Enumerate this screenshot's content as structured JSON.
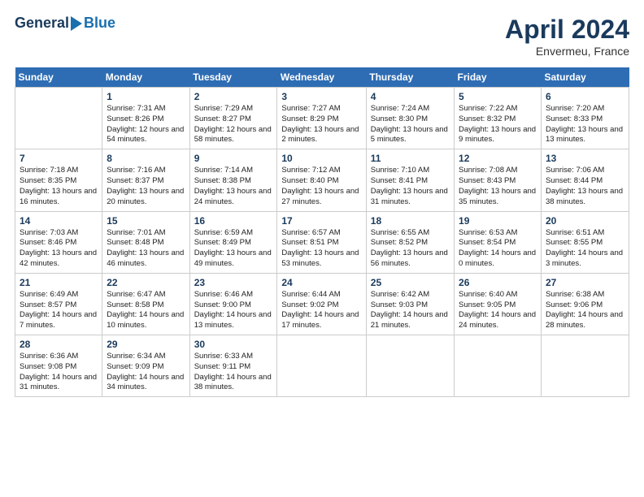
{
  "header": {
    "logo_general": "General",
    "logo_blue": "Blue",
    "month_year": "April 2024",
    "location": "Envermeu, France"
  },
  "weekdays": [
    "Sunday",
    "Monday",
    "Tuesday",
    "Wednesday",
    "Thursday",
    "Friday",
    "Saturday"
  ],
  "weeks": [
    [
      {
        "day": "",
        "sunrise": "",
        "sunset": "",
        "daylight": ""
      },
      {
        "day": "1",
        "sunrise": "Sunrise: 7:31 AM",
        "sunset": "Sunset: 8:26 PM",
        "daylight": "Daylight: 12 hours and 54 minutes."
      },
      {
        "day": "2",
        "sunrise": "Sunrise: 7:29 AM",
        "sunset": "Sunset: 8:27 PM",
        "daylight": "Daylight: 12 hours and 58 minutes."
      },
      {
        "day": "3",
        "sunrise": "Sunrise: 7:27 AM",
        "sunset": "Sunset: 8:29 PM",
        "daylight": "Daylight: 13 hours and 2 minutes."
      },
      {
        "day": "4",
        "sunrise": "Sunrise: 7:24 AM",
        "sunset": "Sunset: 8:30 PM",
        "daylight": "Daylight: 13 hours and 5 minutes."
      },
      {
        "day": "5",
        "sunrise": "Sunrise: 7:22 AM",
        "sunset": "Sunset: 8:32 PM",
        "daylight": "Daylight: 13 hours and 9 minutes."
      },
      {
        "day": "6",
        "sunrise": "Sunrise: 7:20 AM",
        "sunset": "Sunset: 8:33 PM",
        "daylight": "Daylight: 13 hours and 13 minutes."
      }
    ],
    [
      {
        "day": "7",
        "sunrise": "Sunrise: 7:18 AM",
        "sunset": "Sunset: 8:35 PM",
        "daylight": "Daylight: 13 hours and 16 minutes."
      },
      {
        "day": "8",
        "sunrise": "Sunrise: 7:16 AM",
        "sunset": "Sunset: 8:37 PM",
        "daylight": "Daylight: 13 hours and 20 minutes."
      },
      {
        "day": "9",
        "sunrise": "Sunrise: 7:14 AM",
        "sunset": "Sunset: 8:38 PM",
        "daylight": "Daylight: 13 hours and 24 minutes."
      },
      {
        "day": "10",
        "sunrise": "Sunrise: 7:12 AM",
        "sunset": "Sunset: 8:40 PM",
        "daylight": "Daylight: 13 hours and 27 minutes."
      },
      {
        "day": "11",
        "sunrise": "Sunrise: 7:10 AM",
        "sunset": "Sunset: 8:41 PM",
        "daylight": "Daylight: 13 hours and 31 minutes."
      },
      {
        "day": "12",
        "sunrise": "Sunrise: 7:08 AM",
        "sunset": "Sunset: 8:43 PM",
        "daylight": "Daylight: 13 hours and 35 minutes."
      },
      {
        "day": "13",
        "sunrise": "Sunrise: 7:06 AM",
        "sunset": "Sunset: 8:44 PM",
        "daylight": "Daylight: 13 hours and 38 minutes."
      }
    ],
    [
      {
        "day": "14",
        "sunrise": "Sunrise: 7:03 AM",
        "sunset": "Sunset: 8:46 PM",
        "daylight": "Daylight: 13 hours and 42 minutes."
      },
      {
        "day": "15",
        "sunrise": "Sunrise: 7:01 AM",
        "sunset": "Sunset: 8:48 PM",
        "daylight": "Daylight: 13 hours and 46 minutes."
      },
      {
        "day": "16",
        "sunrise": "Sunrise: 6:59 AM",
        "sunset": "Sunset: 8:49 PM",
        "daylight": "Daylight: 13 hours and 49 minutes."
      },
      {
        "day": "17",
        "sunrise": "Sunrise: 6:57 AM",
        "sunset": "Sunset: 8:51 PM",
        "daylight": "Daylight: 13 hours and 53 minutes."
      },
      {
        "day": "18",
        "sunrise": "Sunrise: 6:55 AM",
        "sunset": "Sunset: 8:52 PM",
        "daylight": "Daylight: 13 hours and 56 minutes."
      },
      {
        "day": "19",
        "sunrise": "Sunrise: 6:53 AM",
        "sunset": "Sunset: 8:54 PM",
        "daylight": "Daylight: 14 hours and 0 minutes."
      },
      {
        "day": "20",
        "sunrise": "Sunrise: 6:51 AM",
        "sunset": "Sunset: 8:55 PM",
        "daylight": "Daylight: 14 hours and 3 minutes."
      }
    ],
    [
      {
        "day": "21",
        "sunrise": "Sunrise: 6:49 AM",
        "sunset": "Sunset: 8:57 PM",
        "daylight": "Daylight: 14 hours and 7 minutes."
      },
      {
        "day": "22",
        "sunrise": "Sunrise: 6:47 AM",
        "sunset": "Sunset: 8:58 PM",
        "daylight": "Daylight: 14 hours and 10 minutes."
      },
      {
        "day": "23",
        "sunrise": "Sunrise: 6:46 AM",
        "sunset": "Sunset: 9:00 PM",
        "daylight": "Daylight: 14 hours and 13 minutes."
      },
      {
        "day": "24",
        "sunrise": "Sunrise: 6:44 AM",
        "sunset": "Sunset: 9:02 PM",
        "daylight": "Daylight: 14 hours and 17 minutes."
      },
      {
        "day": "25",
        "sunrise": "Sunrise: 6:42 AM",
        "sunset": "Sunset: 9:03 PM",
        "daylight": "Daylight: 14 hours and 21 minutes."
      },
      {
        "day": "26",
        "sunrise": "Sunrise: 6:40 AM",
        "sunset": "Sunset: 9:05 PM",
        "daylight": "Daylight: 14 hours and 24 minutes."
      },
      {
        "day": "27",
        "sunrise": "Sunrise: 6:38 AM",
        "sunset": "Sunset: 9:06 PM",
        "daylight": "Daylight: 14 hours and 28 minutes."
      }
    ],
    [
      {
        "day": "28",
        "sunrise": "Sunrise: 6:36 AM",
        "sunset": "Sunset: 9:08 PM",
        "daylight": "Daylight: 14 hours and 31 minutes."
      },
      {
        "day": "29",
        "sunrise": "Sunrise: 6:34 AM",
        "sunset": "Sunset: 9:09 PM",
        "daylight": "Daylight: 14 hours and 34 minutes."
      },
      {
        "day": "30",
        "sunrise": "Sunrise: 6:33 AM",
        "sunset": "Sunset: 9:11 PM",
        "daylight": "Daylight: 14 hours and 38 minutes."
      },
      {
        "day": "",
        "sunrise": "",
        "sunset": "",
        "daylight": ""
      },
      {
        "day": "",
        "sunrise": "",
        "sunset": "",
        "daylight": ""
      },
      {
        "day": "",
        "sunrise": "",
        "sunset": "",
        "daylight": ""
      },
      {
        "day": "",
        "sunrise": "",
        "sunset": "",
        "daylight": ""
      }
    ]
  ]
}
